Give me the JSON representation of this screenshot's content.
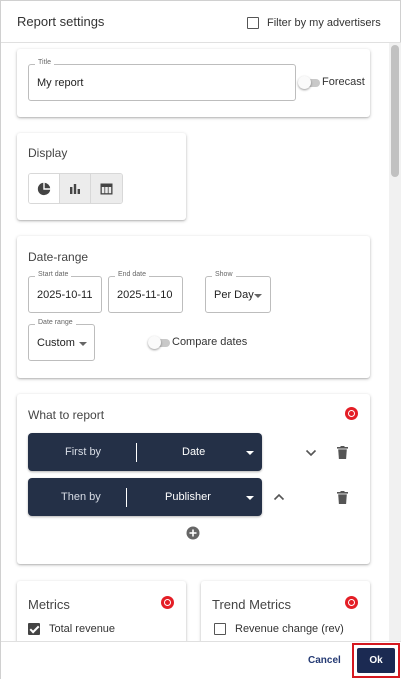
{
  "header": {
    "title": "Report settings",
    "filter_label": "Filter by my advertisers",
    "filter_checked": false
  },
  "title_card": {
    "field_label": "Title",
    "field_value": "My report",
    "forecast_label": "Forecast",
    "forecast_on": false
  },
  "display": {
    "title": "Display",
    "options": [
      {
        "name": "pie-chart-icon",
        "active": false
      },
      {
        "name": "bar-chart-icon",
        "active": true
      },
      {
        "name": "table-icon",
        "active": true
      }
    ]
  },
  "date_range": {
    "title": "Date-range",
    "start": {
      "label": "Start date",
      "value": "2025-10-11"
    },
    "end": {
      "label": "End date",
      "value": "2025-11-10"
    },
    "show": {
      "label": "Show",
      "value": "Per Day"
    },
    "range": {
      "label": "Date range",
      "value": "Custom"
    },
    "compare_label": "Compare dates",
    "compare_on": false
  },
  "what_to_report": {
    "title": "What to report",
    "rows": [
      {
        "key": "First by",
        "value": "Date"
      },
      {
        "key": "Then by",
        "value": "Publisher"
      }
    ]
  },
  "metrics": {
    "title": "Metrics",
    "items": [
      {
        "label": "Total revenue",
        "checked": true
      }
    ]
  },
  "trend_metrics": {
    "title": "Trend Metrics",
    "items": [
      {
        "label": "Revenue change (rev)",
        "checked": false
      }
    ]
  },
  "footer": {
    "cancel_label": "Cancel",
    "ok_label": "Ok"
  },
  "colors": {
    "pill_bg": "#243047",
    "ok_bg": "#1b2a52",
    "highlight": "#d51920",
    "brand_badge": "#e41e26"
  }
}
